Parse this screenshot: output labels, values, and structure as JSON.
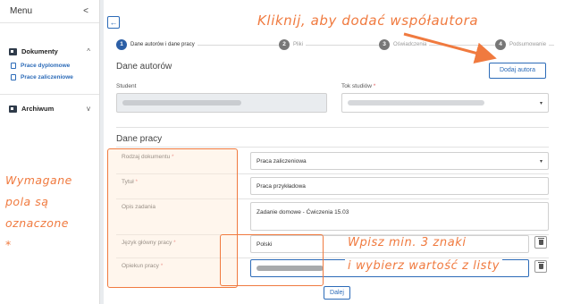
{
  "sidebar": {
    "menu_title": "Menu",
    "collapse_glyph": "<",
    "groups": [
      {
        "label": "Dokumenty",
        "caret": "^",
        "items": [
          {
            "label": "Prace dyplomowe"
          },
          {
            "label": "Prace zaliczeniowe"
          }
        ]
      },
      {
        "label": "Archiwum",
        "caret": "v"
      }
    ]
  },
  "toolbar": {
    "back_glyph": "←"
  },
  "steps": [
    {
      "num": "1",
      "label": "Dane autorów i dane pracy"
    },
    {
      "num": "2",
      "label": "Pliki"
    },
    {
      "num": "3",
      "label": "Oświadczenia"
    },
    {
      "num": "4",
      "label": "Podsumowanie"
    }
  ],
  "authors": {
    "title": "Dane autorów",
    "student_label": "Student",
    "study_label": "Tok studiów",
    "add_author_label": "Dodaj autora"
  },
  "work": {
    "title": "Dane pracy",
    "fields": [
      {
        "label": "Rodzaj dokumentu",
        "value": "Praca zaliczeniowa",
        "required": true
      },
      {
        "label": "Tytuł",
        "value": "Praca przykładowa",
        "required": true
      },
      {
        "label": "Opis zadania",
        "value": "Zadanie domowe - Ćwiczenia 15.03",
        "required": false
      },
      {
        "label": "Język główny pracy",
        "value": "Polski",
        "required": true
      },
      {
        "label": "Opiekun pracy",
        "value": "",
        "required": true
      }
    ],
    "next_label": "Dalej"
  },
  "annotations": {
    "add_author_hint": "Kliknij, aby dodać współautora",
    "required_hint": [
      "Wymagane",
      "pola są",
      "oznaczone",
      "*"
    ],
    "typing_hint_1": "Wpisz min. 3 znaki",
    "typing_hint_2": "i wybierz wartość z listy"
  },
  "required_mark": "*",
  "colors": {
    "accent": "#2c6bb8",
    "annotation": "#f07a3f",
    "required": "#e05b5b"
  }
}
